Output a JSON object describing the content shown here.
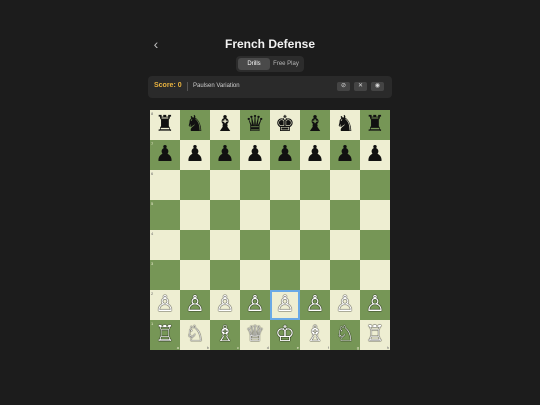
{
  "header": {
    "back_icon": "chevron-left-icon",
    "back_glyph": "‹",
    "title": "French Defense"
  },
  "modes": [
    {
      "label": "Drills",
      "active": true
    },
    {
      "label": "Free Play",
      "active": false
    }
  ],
  "info": {
    "score_label": "Score: 0",
    "variation": "Paulsen Variation",
    "controls": [
      {
        "name": "hint-icon",
        "glyph": "⊘"
      },
      {
        "name": "close-icon",
        "glyph": "✕"
      },
      {
        "name": "eye-icon",
        "glyph": "◉"
      }
    ]
  },
  "board": {
    "ranks": [
      "8",
      "7",
      "6",
      "5",
      "4",
      "3",
      "2",
      "1"
    ],
    "files": [
      "a",
      "b",
      "c",
      "d",
      "e",
      "f",
      "g",
      "h"
    ],
    "rows": [
      [
        "♜",
        "♞",
        "♝",
        "♛",
        "♚",
        "♝",
        "♞",
        "♜"
      ],
      [
        "♟",
        "♟",
        "♟",
        "♟",
        "♟",
        "♟",
        "♟",
        "♟"
      ],
      [
        "",
        "",
        "",
        "",
        "",
        "",
        "",
        ""
      ],
      [
        "",
        "",
        "",
        "",
        "",
        "",
        "",
        ""
      ],
      [
        "",
        "",
        "",
        "",
        "",
        "",
        "",
        ""
      ],
      [
        "",
        "",
        "",
        "",
        "",
        "",
        "",
        ""
      ],
      [
        "♙",
        "♙",
        "♙",
        "♙",
        "♙",
        "♙",
        "♙",
        "♙"
      ],
      [
        "♖",
        "♘",
        "♗",
        "♕",
        "♔",
        "♗",
        "♘",
        "♖"
      ]
    ],
    "colors": {
      "light": "#eeeed2",
      "dark": "#769656",
      "highlight": "#6aa9e6"
    },
    "selected": "e2"
  }
}
